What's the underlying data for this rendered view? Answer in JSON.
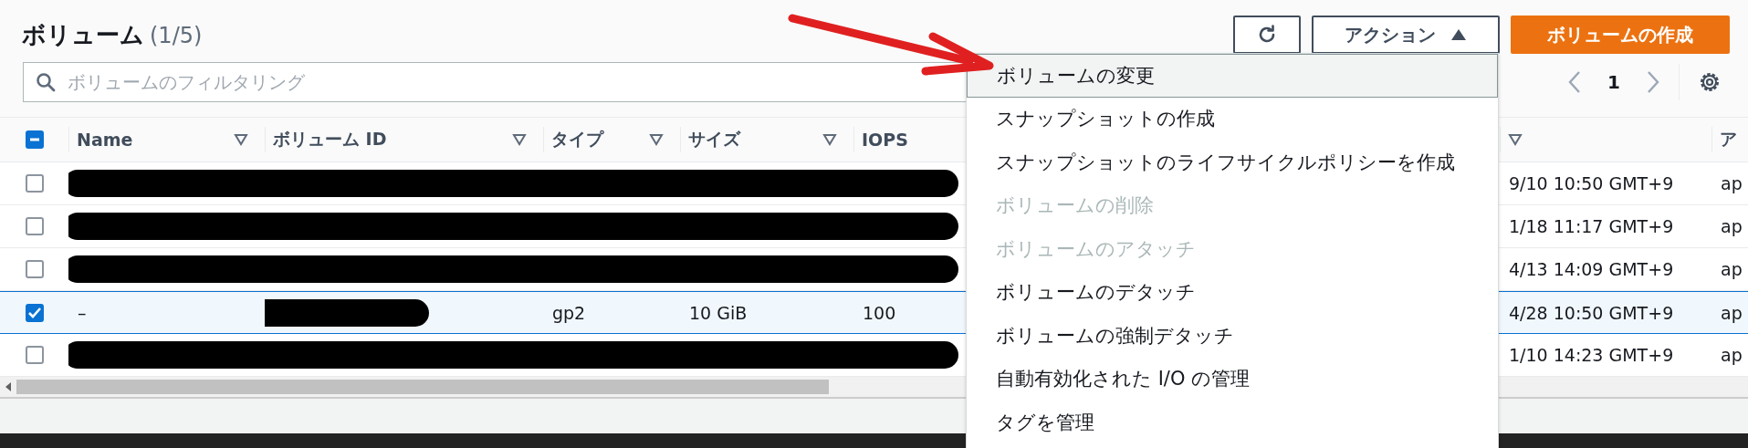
{
  "header": {
    "title": "ボリューム",
    "count": "(1/5)"
  },
  "actions_button": {
    "label": "アクション",
    "expanded": true
  },
  "create_button": {
    "label": "ボリュームの作成"
  },
  "filter": {
    "placeholder": "ボリュームのフィルタリング"
  },
  "pagination": {
    "page": "1"
  },
  "table": {
    "select_all": {
      "indeterminate": true
    },
    "columns": [
      {
        "label": "Name",
        "sortable": true
      },
      {
        "label": "ボリューム ID",
        "sortable": true
      },
      {
        "label": "タイプ",
        "sortable": true
      },
      {
        "label": "サイズ",
        "sortable": true
      },
      {
        "label": "IOPS"
      },
      {
        "sortable": true
      },
      {
        "label": "ア"
      }
    ],
    "rows": [
      {
        "selected": false,
        "redacted": true,
        "created": "9/10 10:50 GMT+9",
        "column_7": "ap"
      },
      {
        "selected": false,
        "redacted": true,
        "created": "1/18 11:17 GMT+9",
        "column_7": "ap"
      },
      {
        "selected": false,
        "redacted": true,
        "created": "4/13 14:09 GMT+9",
        "column_7": "ap"
      },
      {
        "selected": true,
        "redacted": false,
        "name": "–",
        "volume_id_redacted": true,
        "type": "gp2",
        "size": "10 GiB",
        "iops": "100",
        "created": "4/28 10:50 GMT+9",
        "column_7": "ap"
      },
      {
        "selected": false,
        "redacted": true,
        "created": "1/10 14:23 GMT+9",
        "column_7": "ap"
      }
    ]
  },
  "actions_menu": [
    {
      "label": "ボリュームの変更",
      "highlighted": true,
      "disabled": false
    },
    {
      "label": "スナップショットの作成",
      "highlighted": false,
      "disabled": false
    },
    {
      "label": "スナップショットのライフサイクルポリシーを作成",
      "highlighted": false,
      "disabled": false
    },
    {
      "label": "ボリュームの削除",
      "highlighted": false,
      "disabled": true
    },
    {
      "label": "ボリュームのアタッチ",
      "highlighted": false,
      "disabled": true
    },
    {
      "label": "ボリュームのデタッチ",
      "highlighted": false,
      "disabled": false
    },
    {
      "label": "ボリュームの強制デタッチ",
      "highlighted": false,
      "disabled": false
    },
    {
      "label": "自動有効化された I/O の管理",
      "highlighted": false,
      "disabled": false
    },
    {
      "label": "タグを管理",
      "highlighted": false,
      "disabled": false
    }
  ]
}
